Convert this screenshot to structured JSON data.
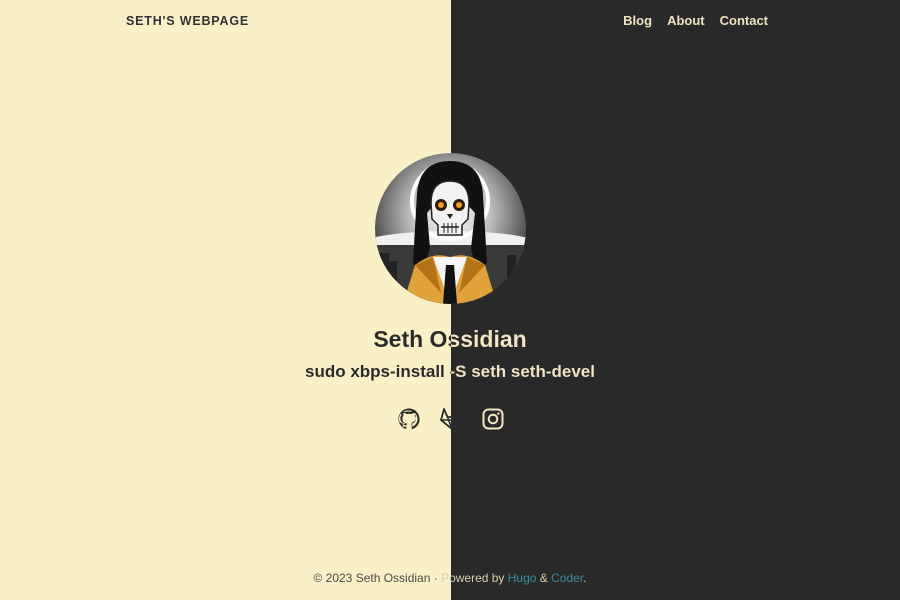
{
  "header": {
    "site_title": "SETH'S WEBPAGE",
    "nav": [
      "Blog",
      "About",
      "Contact"
    ]
  },
  "profile": {
    "name": "Seth Ossidian",
    "tagline": "sudo xbps-install -S seth seth-devel",
    "avatar_description": "avatar-icon"
  },
  "social": [
    {
      "name": "github-icon"
    },
    {
      "name": "gitlab-icon"
    },
    {
      "name": "instagram-icon"
    }
  ],
  "footer": {
    "copyright": "© 2023 Seth Ossidian · ",
    "powered_by": "Powered by ",
    "hugo": "Hugo",
    "amp": " & ",
    "coder": "Coder",
    "period": "."
  },
  "colors": {
    "light_bg": "#faf0c8",
    "dark_bg": "#292929",
    "link": "#3a8ea0"
  }
}
